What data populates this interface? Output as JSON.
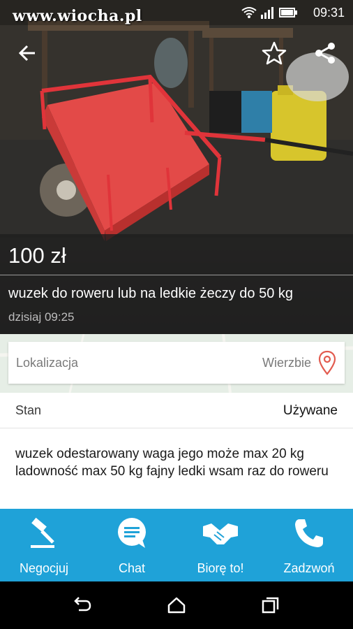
{
  "status_bar": {
    "watermark": "www.wiocha.pl",
    "time": "09:31",
    "icons": [
      "wifi-icon",
      "signal-icon",
      "battery-icon"
    ]
  },
  "toolbar": {
    "icons": [
      "back-arrow-icon",
      "star-icon",
      "share-icon"
    ]
  },
  "listing": {
    "price": "100 zł",
    "title": "wuzek do roweru lub na ledkie żeczy do 50 kg",
    "date": "dzisiaj 09:25"
  },
  "location": {
    "label": "Lokalizacja",
    "value": "Wierzbie",
    "icon": "location-pin-icon"
  },
  "details": {
    "condition_label": "Stan",
    "condition_value": "Używane",
    "description": "wuzek odestarowany waga jego może max 20 kg ladowność max 50 kg fajny ledki wsam raz do roweru"
  },
  "actions": [
    {
      "label": "Negocjuj",
      "icon": "gavel-icon"
    },
    {
      "label": "Chat",
      "icon": "chat-bubble-icon"
    },
    {
      "label": "Biorę to!",
      "icon": "handshake-icon"
    },
    {
      "label": "Zadzwoń",
      "icon": "phone-icon"
    }
  ],
  "colors": {
    "accent": "#1fa2d8",
    "cart_red": "#e0343a",
    "pin": "#e25b4f"
  },
  "nav": {
    "icons": [
      "back-nav-icon",
      "home-nav-icon",
      "recents-nav-icon"
    ]
  }
}
